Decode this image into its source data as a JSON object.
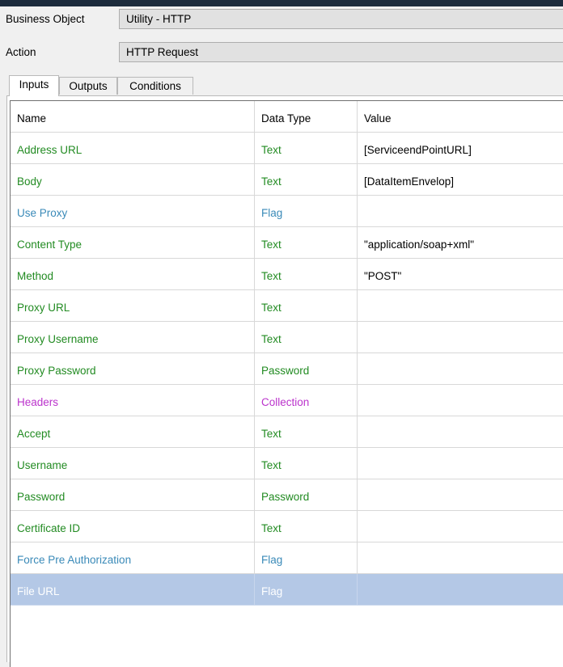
{
  "form": {
    "business_object_label": "Business Object",
    "business_object_value": "Utility - HTTP",
    "action_label": "Action",
    "action_value": "HTTP Request"
  },
  "tabs": [
    {
      "label": "Inputs",
      "active": true
    },
    {
      "label": "Outputs",
      "active": false
    },
    {
      "label": "Conditions",
      "active": false
    }
  ],
  "grid": {
    "columns": [
      "Name",
      "Data Type",
      "Value"
    ],
    "rows": [
      {
        "name": "Address URL",
        "type": "Text",
        "value": "[ServiceendPointURL]"
      },
      {
        "name": "Body",
        "type": "Text",
        "value": "[DataItemEnvelop]"
      },
      {
        "name": "Use Proxy",
        "type": "Flag",
        "value": ""
      },
      {
        "name": "Content Type",
        "type": "Text",
        "value": "\"application/soap+xml\""
      },
      {
        "name": "Method",
        "type": "Text",
        "value": "\"POST\""
      },
      {
        "name": "Proxy URL",
        "type": "Text",
        "value": ""
      },
      {
        "name": "Proxy Username",
        "type": "Text",
        "value": ""
      },
      {
        "name": "Proxy Password",
        "type": "Password",
        "value": ""
      },
      {
        "name": "Headers",
        "type": "Collection",
        "value": ""
      },
      {
        "name": "Accept",
        "type": "Text",
        "value": ""
      },
      {
        "name": "Username",
        "type": "Text",
        "value": ""
      },
      {
        "name": "Password",
        "type": "Password",
        "value": ""
      },
      {
        "name": "Certificate ID",
        "type": "Text",
        "value": ""
      },
      {
        "name": "Force Pre Authorization",
        "type": "Flag",
        "value": ""
      },
      {
        "name": "File URL",
        "type": "Flag",
        "value": "",
        "selected": true
      }
    ]
  },
  "colors": {
    "text_type": "#228b22",
    "flag_type": "#3a8ab8",
    "collection_type": "#bb33cc",
    "selection": "#b4c8e6"
  }
}
